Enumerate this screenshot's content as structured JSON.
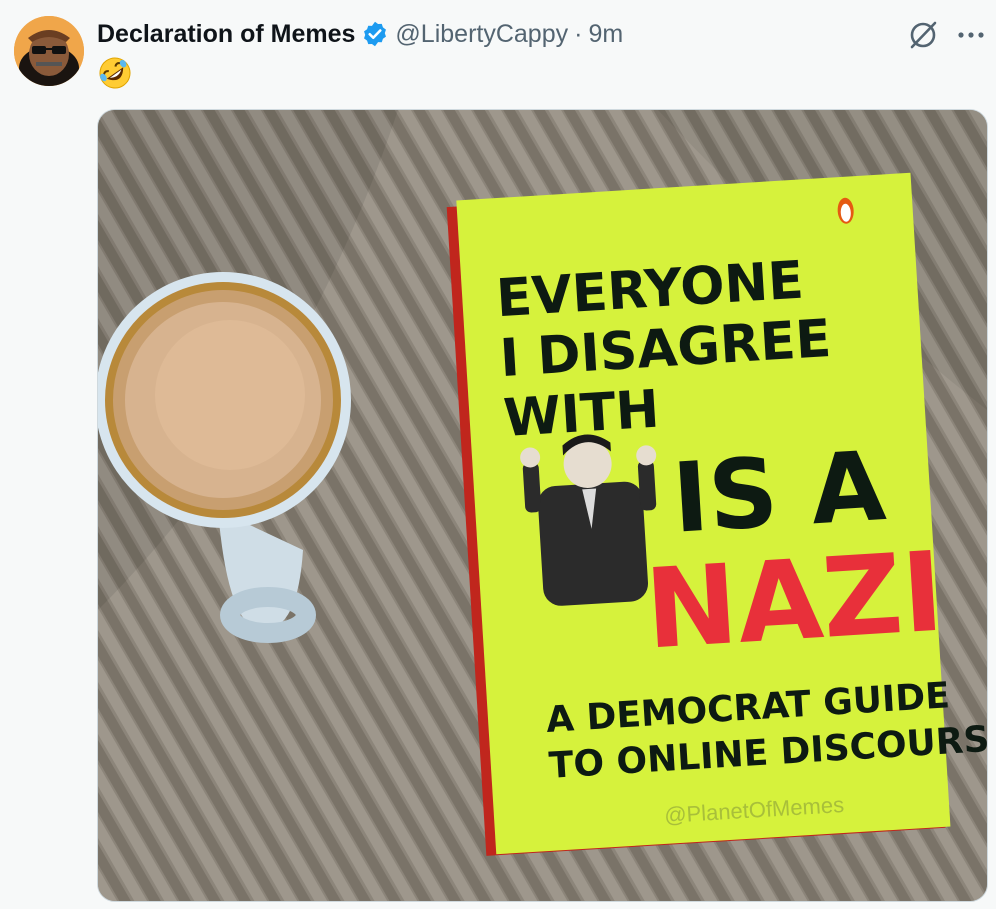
{
  "post": {
    "display_name": "Declaration of Memes",
    "handle": "@LibertyCappy",
    "separator": "·",
    "time": "9m",
    "text_emoji": "rolling-on-floor-laughing"
  },
  "icons": {
    "verified": "verified-badge-icon",
    "grok": "grok-icon",
    "more": "more-icon"
  },
  "colors": {
    "verified": "#1d9bf0",
    "muted": "#536471",
    "book_cover": "#d6f23c",
    "book_red_text": "#e8303a"
  },
  "media": {
    "book": {
      "line1": "EVERYONE",
      "line2": "I DISAGREE",
      "line3": "WITH",
      "line4": "IS A",
      "line5": "NAZI",
      "subtitle1": "A DEMOCRAT GUIDE",
      "subtitle2": "TO ONLINE DISCOURSE",
      "watermark": "@PlanetOfMemes"
    }
  }
}
